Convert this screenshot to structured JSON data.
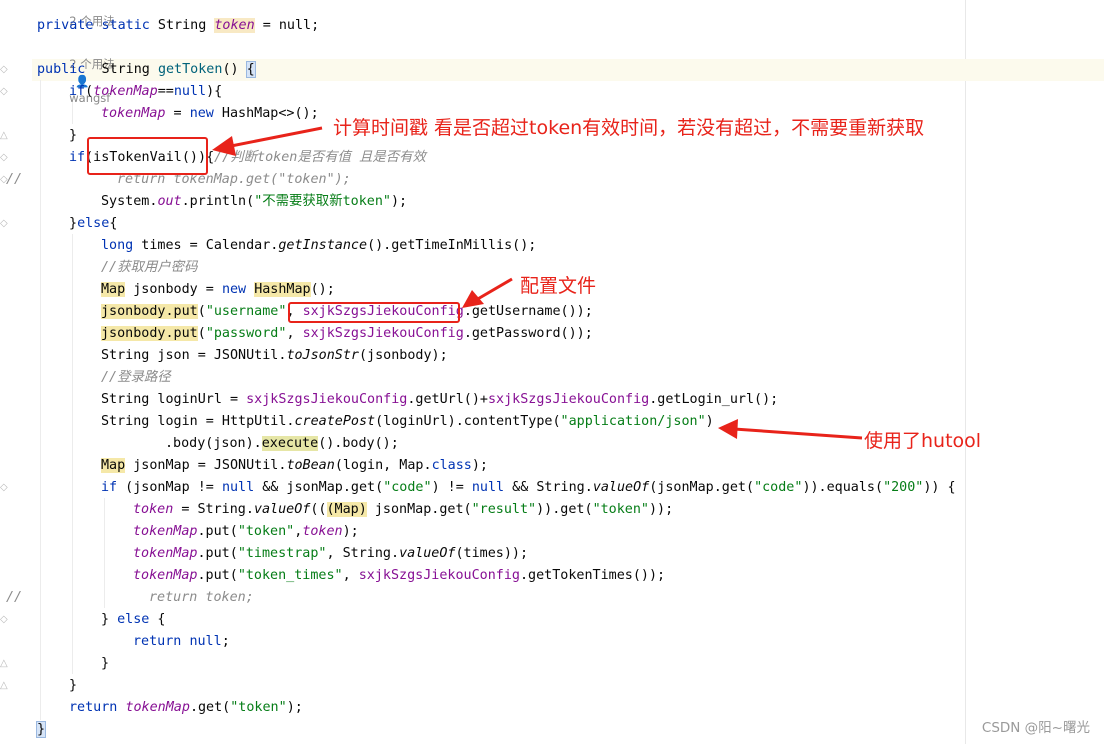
{
  "hints": {
    "usages_1": "2 个用法",
    "usages_2": "2 个用法",
    "author": "wangsf"
  },
  "code": {
    "l0_kw": "private static",
    "l0_type": " String ",
    "l0_field": "token",
    "l0_rest": " = null;",
    "l2_kw": "public",
    "l2_type": "  String ",
    "l2_method": "getToken",
    "l2_rest": "() ",
    "l2_brace": "{",
    "l3_kw": "if",
    "l3_p1": "(",
    "l3_field": "tokenMap",
    "l3_p2": "==",
    "l3_null": "null",
    "l3_p3": "){",
    "l4_field": "tokenMap",
    "l4_p1": " = ",
    "l4_new": "new",
    "l4_p2": " HashMap<>();",
    "l5": "}",
    "l6_kw": "if",
    "l6_p1": "(isTokenVail())",
    "l6_p2": "{",
    "l6_cm": "//判断token是否有值 且是否有效",
    "l7_cm": "return tokenMap.get(\"token\");",
    "l7_slash": "//",
    "l8_p1": "System.",
    "l8_static": "out",
    "l8_p2": ".println(",
    "l8_str": "\"不需要获取新token\"",
    "l8_p3": ");",
    "l9_p1": "}",
    "l9_kw": "else",
    "l9_p2": "{",
    "l10_kw": "long",
    "l10_p1": " times = Calendar.",
    "l10_static": "getInstance",
    "l10_p2": "().getTimeInMillis();",
    "l11_cm": "//获取用户密码",
    "l12_type": "Map",
    "l12_p1": " jsonbody = ",
    "l12_new": "new",
    "l12_p2": " ",
    "l12_type2": "HashMap",
    "l12_p3": "();",
    "l13_var": "jsonbody.put",
    "l13_p1": "(",
    "l13_str": "\"username\"",
    "l13_p2": ", ",
    "l13_field": "sxjkSzgsJiekouConfig",
    "l13_p3": ".getUsername());",
    "l14_var": "jsonbody.put",
    "l14_p1": "(",
    "l14_str": "\"password\"",
    "l14_p2": ", ",
    "l14_field": "sxjkSzgsJiekouConfig",
    "l14_p3": ".getPassword());",
    "l15_p1": "String json = JSONUtil.",
    "l15_static": "toJsonStr",
    "l15_p2": "(jsonbody);",
    "l16_cm": "//登录路径",
    "l17_p1": "String loginUrl = ",
    "l17_field": "sxjkSzgsJiekouConfig",
    "l17_p2": ".getUrl()+",
    "l17_field2": "sxjkSzgsJiekouConfig",
    "l17_p3": ".getLogin_url();",
    "l18_p1": "String login = HttpUtil.",
    "l18_static": "createPost",
    "l18_p2": "(loginUrl).contentType(",
    "l18_str": "\"application/json\"",
    "l18_p3": ")",
    "l19_p1": ".body(json).",
    "l19_hl": "execute",
    "l19_p2": "().body();",
    "l20_type": "Map",
    "l20_p1": " jsonMap = JSONUtil.",
    "l20_static": "toBean",
    "l20_p2": "(login, Map.",
    "l20_kw": "class",
    "l20_p3": ");",
    "l21_kw": "if",
    "l21_p1": " (jsonMap != ",
    "l21_null": "null",
    "l21_p2": " && jsonMap.get(",
    "l21_str": "\"code\"",
    "l21_p3": ") != ",
    "l21_null2": "null",
    "l21_p4": " && String.",
    "l21_static": "valueOf",
    "l21_p5": "(jsonMap.get(",
    "l21_str2": "\"code\"",
    "l21_p6": ")).equals(",
    "l21_str3": "\"200\"",
    "l21_p7": ")) {",
    "l22_field": "token",
    "l22_p1": " = String.",
    "l22_static": "valueOf",
    "l22_p2": "((",
    "l22_type": "(Map)",
    "l22_p3": " jsonMap.get(",
    "l22_str": "\"result\"",
    "l22_p4": ")).get(",
    "l22_str2": "\"token\"",
    "l22_p5": "));",
    "l23_field": "tokenMap",
    "l23_p1": ".put(",
    "l23_str": "\"token\"",
    "l23_p2": ",",
    "l23_field2": "token",
    "l23_p3": ");",
    "l24_field": "tokenMap",
    "l24_p1": ".put(",
    "l24_str": "\"timestrap\"",
    "l24_p2": ", String.",
    "l24_static": "valueOf",
    "l24_p3": "(times));",
    "l25_field": "tokenMap",
    "l25_p1": ".put(",
    "l25_str": "\"token_times\"",
    "l25_p2": ", ",
    "l25_field2": "sxjkSzgsJiekouConfig",
    "l25_p3": ".getTokenTimes());",
    "l26_slash": "//",
    "l26_cm": "return token;",
    "l27_p1": "} ",
    "l27_kw": "else",
    "l27_p2": " {",
    "l28_kw": "return",
    "l28_p1": " ",
    "l28_null": "null",
    "l28_p2": ";",
    "l29": "}",
    "l30": "}",
    "l31_kw": "return",
    "l31_p1": " ",
    "l31_field": "tokenMap",
    "l31_p2": ".get(",
    "l31_str": "\"token\"",
    "l31_p3": ");",
    "l32": "}"
  },
  "annotations": {
    "note1": "计算时间戳 看是否超过token有效时间，若没有超过，不需要重新获取",
    "note2": "配置文件",
    "note3": "使用了hutool",
    "color": "#e8231a"
  },
  "watermark": "CSDN @阳~曙光"
}
